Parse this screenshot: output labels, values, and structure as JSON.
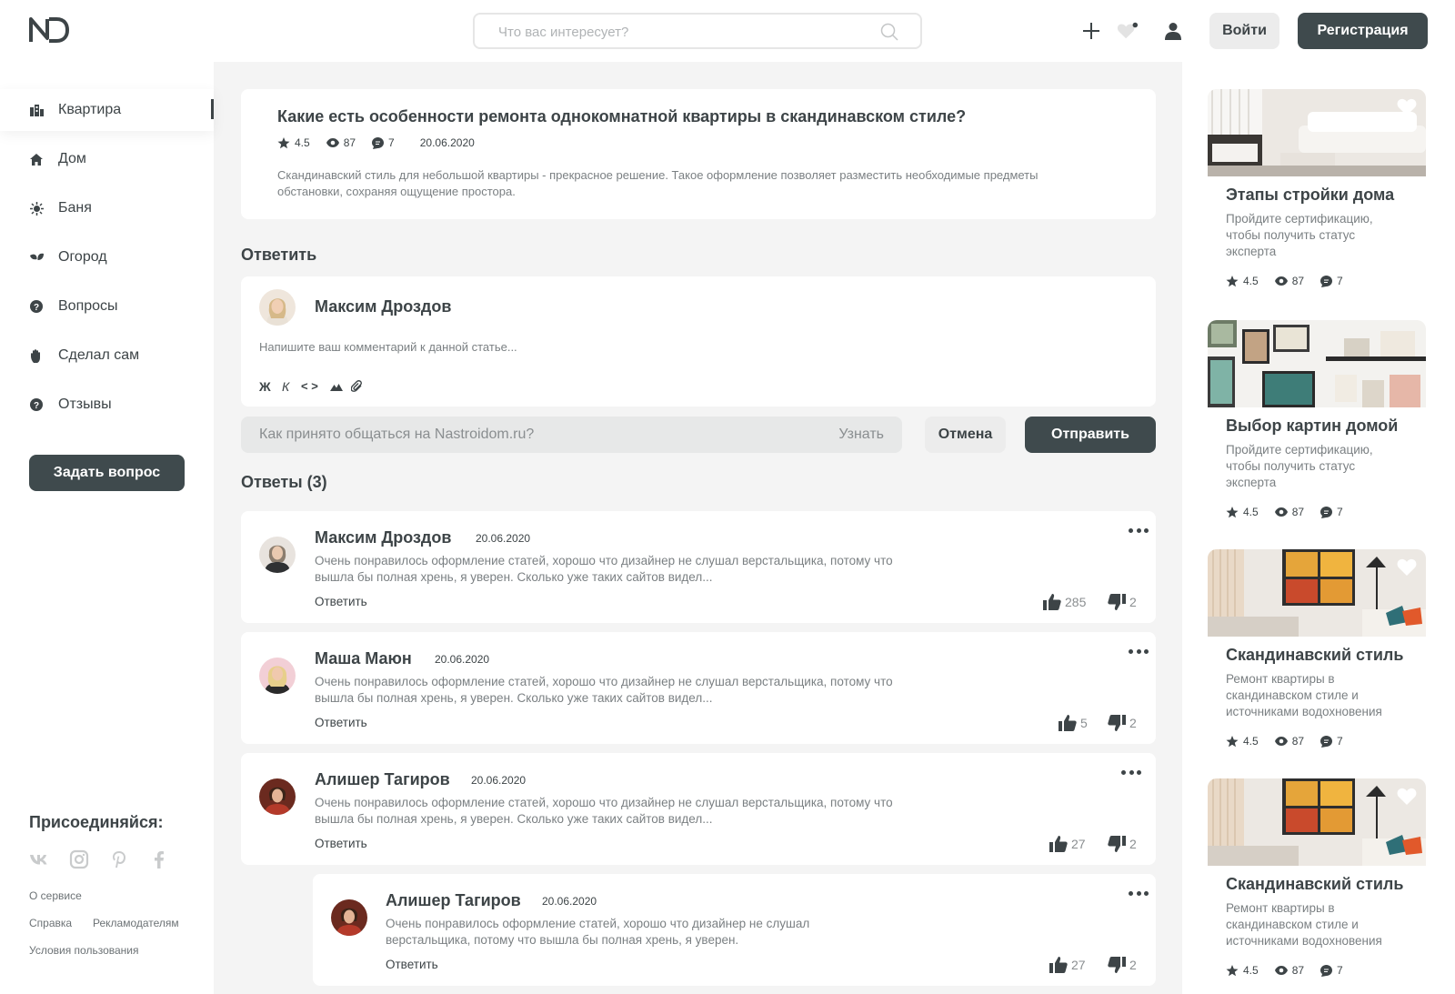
{
  "header": {
    "logo_text": "ND",
    "search_placeholder": "Что вас интересует?",
    "login_label": "Войти",
    "register_label": "Регистрация"
  },
  "sidebar": {
    "items": [
      {
        "label": "Квартира",
        "icon": "building-icon"
      },
      {
        "label": "Дом",
        "icon": "house-icon"
      },
      {
        "label": "Баня",
        "icon": "sauna-icon"
      },
      {
        "label": "Огород",
        "icon": "leaf-icon"
      },
      {
        "label": "Вопросы",
        "icon": "question-icon"
      },
      {
        "label": "Сделал сам",
        "icon": "hand-icon"
      },
      {
        "label": "Отзывы",
        "icon": "review-icon"
      }
    ],
    "ask_button": "Задать вопрос",
    "join_title": "Присоединяйся:",
    "social": [
      "vk-icon",
      "instagram-icon",
      "pinterest-icon",
      "facebook-icon"
    ],
    "footer_links": [
      "О сервисе",
      "Справка",
      "Рекламодателям",
      "Условия пользования"
    ]
  },
  "question": {
    "title": "Какие есть особенности ремонта однокомнатной квартиры в скандинавском стиле?",
    "rating": "4.5",
    "views": "87",
    "comments": "7",
    "date": "20.06.2020",
    "text": "Скандинавский стиль для небольшой квартиры - прекрасное решение. Такое оформление позволяет разместить необходимые предметы обстановки, сохраняя ощущение простора."
  },
  "reply_form": {
    "section_title": "Ответить",
    "author": "Максим Дроздов",
    "placeholder": "Напишите ваш комментарий к данной статье...",
    "format_bold": "Ж",
    "format_italic": "К",
    "format_code": "< >",
    "info_text": "Как принято общаться на Nastroidom.ru?",
    "info_link": "Узнать",
    "cancel_label": "Отмена",
    "submit_label": "Отправить"
  },
  "answers": {
    "title": "Ответы (3)",
    "reply_label": "Ответить",
    "items": [
      {
        "author": "Максим Дроздов",
        "date": "20.06.2020",
        "text": "Очень понравилось оформление статей, хорошо что дизайнер не слушал верстальщика, потому что вышла бы полная хрень, я уверен. Сколько уже таких сайтов видел...",
        "likes": "285",
        "dislikes": "2"
      },
      {
        "author": "Маша Маюн",
        "date": "20.06.2020",
        "text": "Очень понравилось оформление статей, хорошо что дизайнер не слушал верстальщика, потому что вышла бы полная хрень, я уверен. Сколько уже таких сайтов видел...",
        "likes": "5",
        "dislikes": "2"
      },
      {
        "author": "Алишер Тагиров",
        "date": "20.06.2020",
        "text": "Очень понравилось оформление статей, хорошо что дизайнер не слушал верстальщика, потому что вышла бы полная хрень, я уверен. Сколько уже таких сайтов видел...",
        "likes": "27",
        "dislikes": "2"
      },
      {
        "author": "Алишер Тагиров",
        "date": "20.06.2020",
        "text": "Очень понравилось оформление статей, хорошо что дизайнер не слушал верстальщика, потому что вышла бы полная хрень, я уверен.",
        "likes": "27",
        "dislikes": "2"
      }
    ]
  },
  "related": [
    {
      "title": "Этапы стройки дома",
      "desc": "Пройдите сертификацию, чтобы получить статус эксперта",
      "rating": "4.5",
      "views": "87",
      "comments": "7"
    },
    {
      "title": "Выбор картин домой",
      "desc": "Пройдите сертификацию, чтобы получить статус эксперта",
      "rating": "4.5",
      "views": "87",
      "comments": "7"
    },
    {
      "title": "Скандинавский стиль",
      "desc": "Ремонт квартиры в скандинавском стиле и источниками водохновения",
      "rating": "4.5",
      "views": "87",
      "comments": "7"
    },
    {
      "title": "Скандинавский стиль",
      "desc": "Ремонт квартиры в скандинавском стиле и источниками водохновения",
      "rating": "4.5",
      "views": "87",
      "comments": "7"
    }
  ],
  "colors": {
    "accent_dark": "#3f4a4d",
    "text": "#3d4447",
    "muted": "#7b8083",
    "background": "#f4f4f4"
  }
}
